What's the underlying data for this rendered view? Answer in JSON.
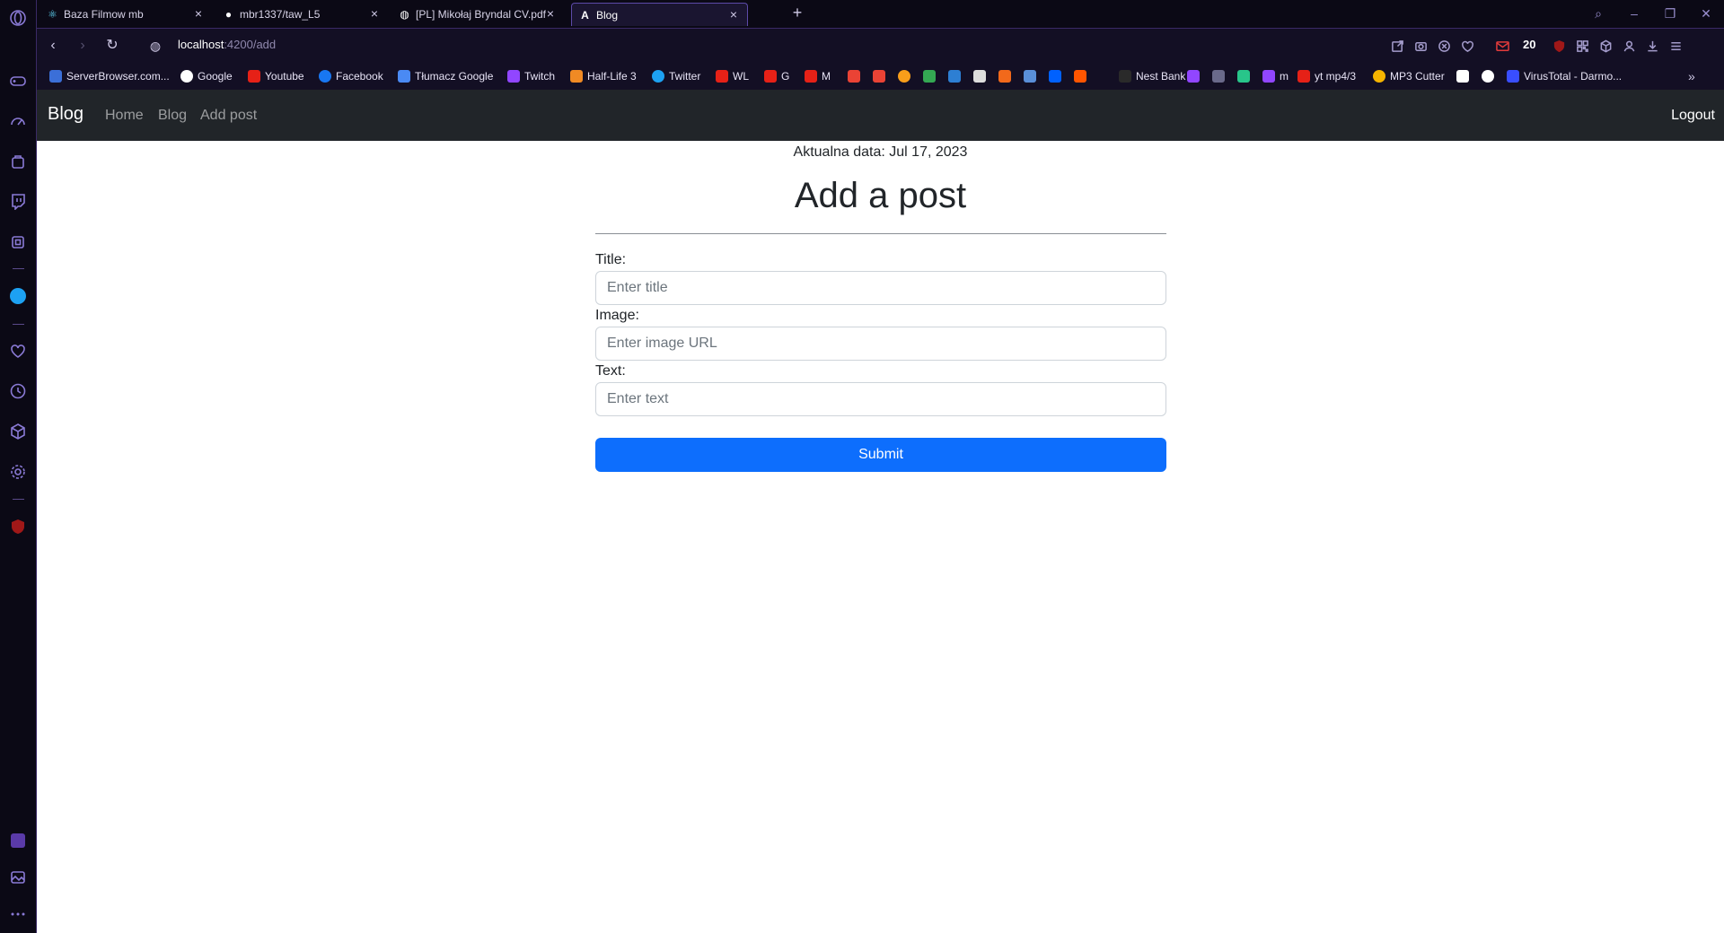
{
  "browser": {
    "tabs": [
      {
        "label": "Baza Filmow mb"
      },
      {
        "label": "mbr1337/taw_L5"
      },
      {
        "label": "[PL] Mikołaj Bryndal CV.pdf"
      },
      {
        "label": "Blog"
      }
    ],
    "new_tab": "+",
    "url_host": "localhost",
    "url_path": ":4200/add",
    "mail_count": "20",
    "bookmarks": [
      {
        "label": "ServerBrowser.com...",
        "color": "#3b6fd8"
      },
      {
        "label": "Google",
        "color": "#ffffff"
      },
      {
        "label": "Youtube",
        "color": "#e62117"
      },
      {
        "label": "Facebook",
        "color": "#1877f2"
      },
      {
        "label": "Tłumacz Google",
        "color": "#4a8af4"
      },
      {
        "label": "Twitch",
        "color": "#9146ff"
      },
      {
        "label": "Half-Life 3",
        "color": "#f08a24"
      },
      {
        "label": "Twitter",
        "color": "#1da1f2"
      },
      {
        "label": "WL",
        "color": "#e62117"
      },
      {
        "label": "G",
        "color": "#e62117"
      },
      {
        "label": "M",
        "color": "#e62117"
      },
      {
        "label": "Nest Bank",
        "color": "#2a2a2a"
      },
      {
        "label": "m",
        "color": "#9146ff"
      },
      {
        "label": "yt mp4/3",
        "color": "#e62117"
      },
      {
        "label": "MP3 Cutter",
        "color": "#f5b400"
      },
      {
        "label": "VirusTotal - Darmo...",
        "color": "#394eff"
      }
    ]
  },
  "navbar": {
    "brand": "Blog",
    "links": [
      "Home",
      "Blog",
      "Add post"
    ],
    "logout": "Logout"
  },
  "main": {
    "date": "Aktualna data: Jul 17, 2023",
    "heading": "Add a post",
    "fields": [
      {
        "label": "Title:",
        "placeholder": "Enter title"
      },
      {
        "label": "Image:",
        "placeholder": "Enter image URL"
      },
      {
        "label": "Text:",
        "placeholder": "Enter text"
      }
    ],
    "submit": "Submit"
  },
  "colors": {
    "navbar_bg": "#212529",
    "primary": "#0d6efd",
    "browser_accent": "#5c4aa8"
  }
}
